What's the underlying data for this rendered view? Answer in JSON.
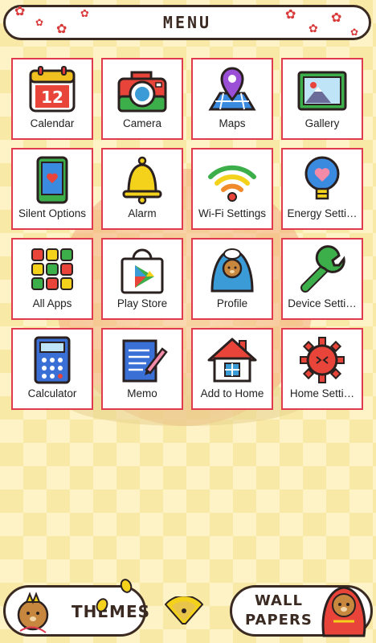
{
  "header": {
    "title": "MENU"
  },
  "tiles": [
    {
      "label": "Calendar",
      "icon": "calendar-icon"
    },
    {
      "label": "Camera",
      "icon": "camera-icon"
    },
    {
      "label": "Maps",
      "icon": "map-pin-icon"
    },
    {
      "label": "Gallery",
      "icon": "gallery-icon"
    },
    {
      "label": "Silent Options",
      "icon": "phone-heart-icon"
    },
    {
      "label": "Alarm",
      "icon": "bell-icon"
    },
    {
      "label": "Wi-Fi Settings",
      "icon": "wifi-icon"
    },
    {
      "label": "Energy Setti…",
      "icon": "lightbulb-heart-icon"
    },
    {
      "label": "All Apps",
      "icon": "grid-apps-icon"
    },
    {
      "label": "Play Store",
      "icon": "play-store-bag-icon"
    },
    {
      "label": "Profile",
      "icon": "hooded-character-icon"
    },
    {
      "label": "Device Setti…",
      "icon": "wrench-icon"
    },
    {
      "label": "Calculator",
      "icon": "calculator-icon"
    },
    {
      "label": "Memo",
      "icon": "memo-pencil-icon"
    },
    {
      "label": "Add to Home",
      "icon": "house-icon"
    },
    {
      "label": "Home Setti…",
      "icon": "gear-icon"
    }
  ],
  "calendar_day": "12",
  "themes_button": {
    "label": "THEMES"
  },
  "wallpapers_button": {
    "line1": "WALL",
    "line2": "PAPERS"
  },
  "colors": {
    "tile_border": "#e03a4e",
    "outline": "#3a2a22"
  }
}
